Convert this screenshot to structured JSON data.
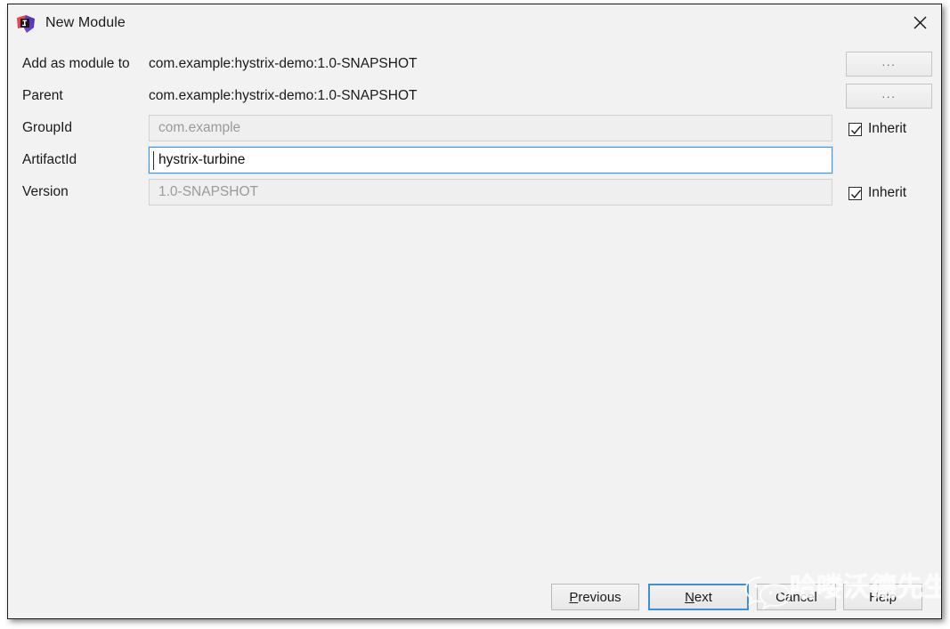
{
  "window": {
    "title": "New Module",
    "app_icon": "intellij-idea-icon",
    "close_icon": "close-icon"
  },
  "form": {
    "rows": [
      {
        "label": "Add as module to",
        "value": "com.example:hystrix-demo:1.0-SNAPSHOT",
        "kind": "static",
        "trailing": "browse"
      },
      {
        "label": "Parent",
        "value": "com.example:hystrix-demo:1.0-SNAPSHOT",
        "kind": "static",
        "trailing": "browse"
      },
      {
        "label": "GroupId",
        "value": "com.example",
        "kind": "field",
        "enabled": false,
        "trailing": "inherit"
      },
      {
        "label": "ArtifactId",
        "value": "hystrix-turbine",
        "kind": "field",
        "enabled": true,
        "trailing": "none"
      },
      {
        "label": "Version",
        "value": "1.0-SNAPSHOT",
        "kind": "field",
        "enabled": false,
        "trailing": "inherit"
      }
    ],
    "browse_label": "...",
    "inherit_label": "Inherit",
    "inherit_checked": true
  },
  "footer": {
    "previous": {
      "label": "Previous",
      "mnemonic": "P"
    },
    "next": {
      "label": "Next",
      "mnemonic": "N",
      "default": true
    },
    "cancel": {
      "label": "Cancel",
      "mnemonic": ""
    },
    "help": {
      "label": "Help",
      "mnemonic": ""
    }
  },
  "watermark": {
    "text": "哈喽沃德先生",
    "logo": "wechat-icon"
  },
  "colors": {
    "dialog_bg": "#f2f2f2",
    "focus_blue": "#3d9ae8",
    "default_button_blue": "#3d8fd6",
    "disabled_text": "#9a9a9a",
    "text": "#1a1a1a"
  }
}
